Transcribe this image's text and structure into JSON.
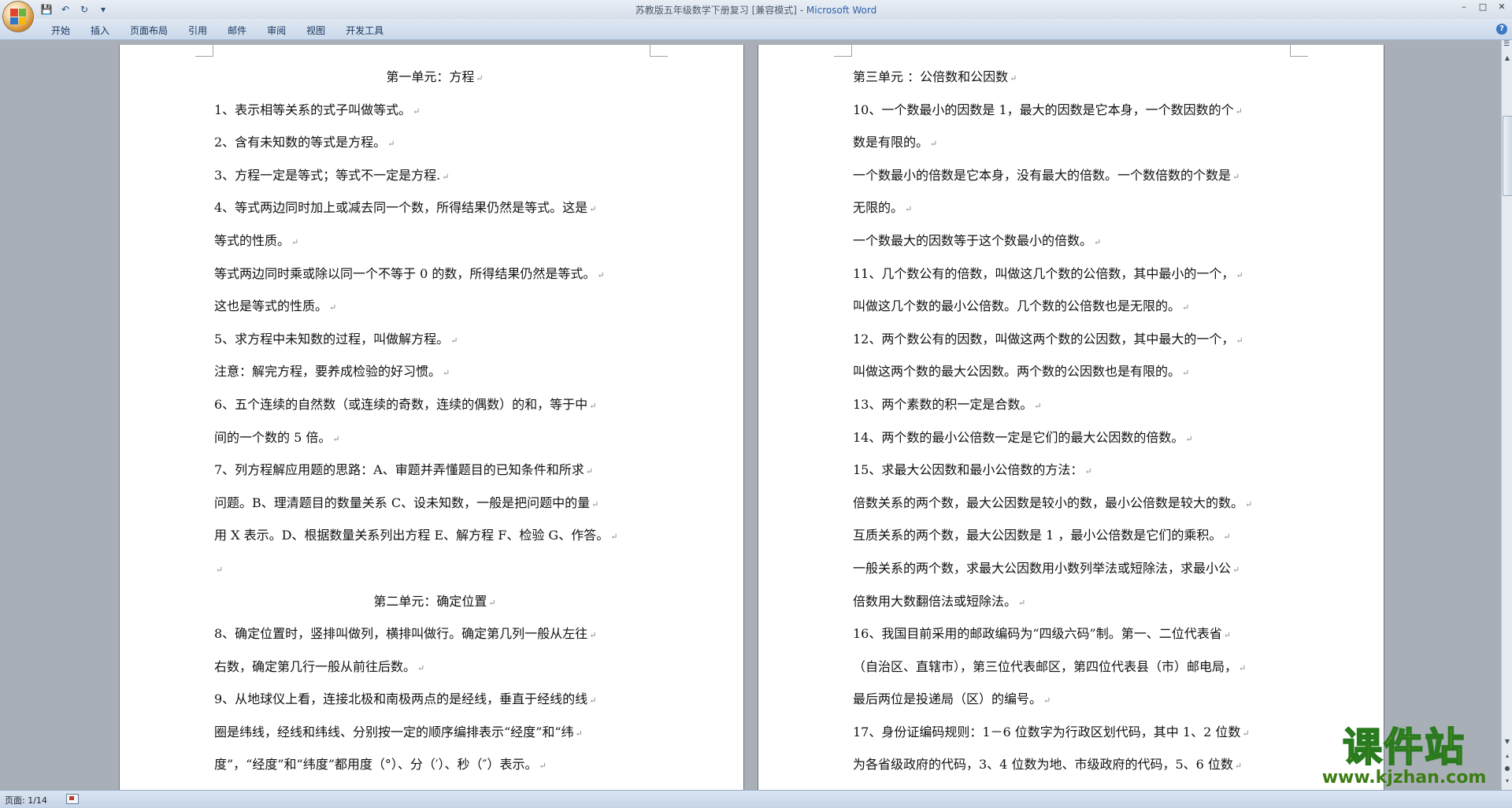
{
  "window": {
    "title": "苏教版五年级数学下册复习 [兼容模式] - ",
    "app_name": "Microsoft Word"
  },
  "ribbon": {
    "tabs": [
      "开始",
      "插入",
      "页面布局",
      "引用",
      "邮件",
      "审阅",
      "视图",
      "开发工具"
    ]
  },
  "qat": {
    "save_icon": "save-icon",
    "undo_icon": "undo-icon",
    "redo_icon": "redo-icon"
  },
  "page1": {
    "lines": [
      "第一单元：方程",
      "1、表示相等关系的式子叫做等式。",
      "2、含有未知数的等式是方程。",
      "3、方程一定是等式；等式不一定是方程.",
      "4、等式两边同时加上或减去同一个数，所得结果仍然是等式。这是",
      "等式的性质。",
      "等式两边同时乘或除以同一个不等于 0 的数，所得结果仍然是等式。",
      "这也是等式的性质。",
      "5、求方程中未知数的过程，叫做解方程。",
      "注意：解完方程，要养成检验的好习惯。",
      "6、五个连续的自然数（或连续的奇数，连续的偶数）的和，等于中",
      "间的一个数的 5 倍。",
      "7、列方程解应用题的思路：A、审题并弄懂题目的已知条件和所求",
      "问题。B、理清题目的数量关系 C、设未知数，一般是把问题中的量",
      "用 X 表示。D、根据数量关系列出方程 E、解方程 F、检验 G、作答。",
      "",
      "第二单元：确定位置",
      "8、确定位置时，竖排叫做列，横排叫做行。确定第几列一般从左往",
      "右数，确定第几行一般从前往后数。",
      "9、从地球仪上看，连接北极和南极两点的是经线，垂直于经线的线",
      "圈是纬线，经线和纬线、分别按一定的顺序编排表示“经度”和“纬",
      "度”，“经度”和“纬度”都用度（°）、分（′）、秒（″）表示。"
    ]
  },
  "page2": {
    "lines": [
      "第三单元 ：公倍数和公因数",
      "10、一个数最小的因数是 1，最大的因数是它本身，一个数因数的个",
      "数是有限的。",
      "一个数最小的倍数是它本身，没有最大的倍数。一个数倍数的个数是",
      "无限的。",
      "一个数最大的因数等于这个数最小的倍数。",
      "11、几个数公有的倍数，叫做这几个数的公倍数，其中最小的一个，",
      "叫做这几个数的最小公倍数。几个数的公倍数也是无限的。",
      "12、两个数公有的因数，叫做这两个数的公因数，其中最大的一个，",
      "叫做这两个数的最大公因数。两个数的公因数也是有限的。",
      "13、两个素数的积一定是合数。",
      "14、两个数的最小公倍数一定是它们的最大公因数的倍数。",
      "15、求最大公因数和最小公倍数的方法：",
      "倍数关系的两个数，最大公因数是较小的数，最小公倍数是较大的数。",
      "互质关系的两个数，最大公因数是 1 ，最小公倍数是它们的乘积。",
      "一般关系的两个数，求最大公因数用小数列举法或短除法，求最小公",
      "倍数用大数翻倍法或短除法。",
      "16、我国目前采用的邮政编码为“四级六码”制。第一、二位代表省",
      "（自治区、直辖市），第三位代表邮区，第四位代表县（市）邮电局，",
      "最后两位是投递局（区）的编号。",
      "17、身份证编码规则：1－6 位数字为行政区划代码，其中 1、2 位数",
      "为各省级政府的代码，3、4 位数为地、市级政府的代码，5、6 位数"
    ]
  },
  "status": {
    "page": "页面: 1/14"
  },
  "watermark": {
    "text": "课件站",
    "url": "www.kjzhan.com"
  }
}
